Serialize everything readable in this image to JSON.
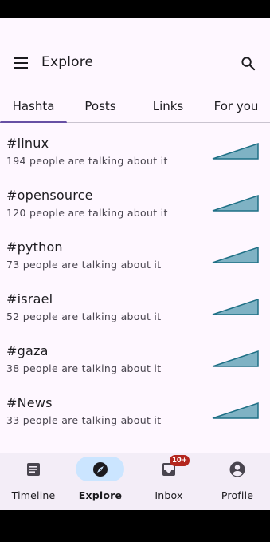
{
  "header": {
    "title": "Explore"
  },
  "tabs": [
    {
      "label": "Hashta"
    },
    {
      "label": "Posts"
    },
    {
      "label": "Links"
    },
    {
      "label": "For you"
    }
  ],
  "selected_tab": "Hashta",
  "hashtags": [
    {
      "tag": "#linux",
      "count_text": "194 people are talking about it"
    },
    {
      "tag": "#opensource",
      "count_text": "120 people are talking about it"
    },
    {
      "tag": "#python",
      "count_text": "73 people are talking about it"
    },
    {
      "tag": "#israel",
      "count_text": "52 people are talking about it"
    },
    {
      "tag": "#gaza",
      "count_text": "38 people are talking about it"
    },
    {
      "tag": "#News",
      "count_text": "33 people are talking about it"
    }
  ],
  "bottom_nav": {
    "items": [
      {
        "label": "Timeline",
        "icon": "article-icon"
      },
      {
        "label": "Explore",
        "icon": "compass-icon"
      },
      {
        "label": "Inbox",
        "icon": "inbox-icon",
        "badge": "10+"
      },
      {
        "label": "Profile",
        "icon": "account-circle-icon"
      }
    ],
    "active": "Explore"
  },
  "colors": {
    "background": "#fef7ff",
    "accent": "#6750a4",
    "sparkline_fill": "#7fb2c4",
    "sparkline_stroke": "#1e6f85",
    "nav_active_pill": "#cbe5ff",
    "badge": "#b3261e"
  }
}
